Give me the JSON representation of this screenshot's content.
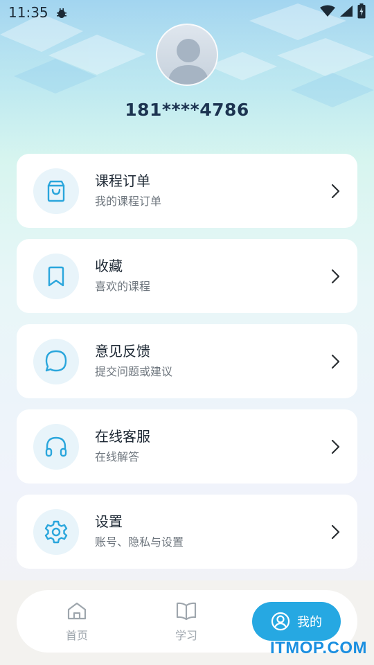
{
  "status_bar": {
    "time": "11:35"
  },
  "profile": {
    "username": "181****4786"
  },
  "menu": {
    "items": [
      {
        "title": "课程订单",
        "subtitle": "我的课程订单",
        "icon": "shopping-bag-icon"
      },
      {
        "title": "收藏",
        "subtitle": "喜欢的课程",
        "icon": "bookmark-icon"
      },
      {
        "title": "意见反馈",
        "subtitle": "提交问题或建议",
        "icon": "chat-bubble-icon"
      },
      {
        "title": "在线客服",
        "subtitle": "在线解答",
        "icon": "headphones-icon"
      },
      {
        "title": "设置",
        "subtitle": "账号、隐私与设置",
        "icon": "gear-icon"
      }
    ]
  },
  "tabbar": {
    "tabs": [
      {
        "label": "首页",
        "icon": "home-icon",
        "active": false
      },
      {
        "label": "学习",
        "icon": "book-icon",
        "active": false
      },
      {
        "label": "我的",
        "icon": "user-circle-icon",
        "active": true
      }
    ]
  },
  "watermark": "ITMOP.COM",
  "colors": {
    "accent": "#26a8e2",
    "icon": "#2aa6dc",
    "icon_bg": "#e8f4fa",
    "title": "#1c3350"
  }
}
